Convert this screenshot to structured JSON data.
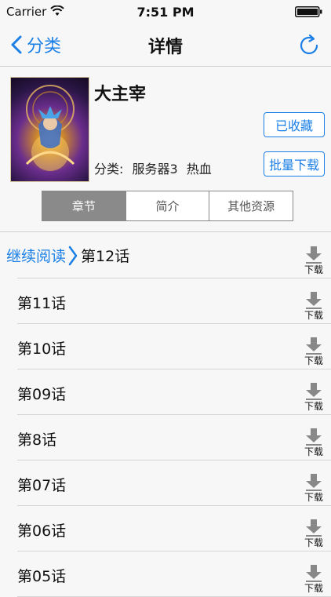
{
  "status_bar": {
    "carrier": "Carrier",
    "time": "7:51 PM"
  },
  "nav": {
    "back_label": "分类",
    "title": "详情"
  },
  "book": {
    "title": "大主宰",
    "category_label": "分类:",
    "server": "服务器3",
    "genre": "热血",
    "favorite_label": "已收藏",
    "batch_download_label": "批量下载"
  },
  "tabs": [
    {
      "label": "章节",
      "active": true
    },
    {
      "label": "简介",
      "active": false
    },
    {
      "label": "其他资源",
      "active": false
    }
  ],
  "continue_reading": {
    "label": "继续阅读",
    "chapter": "第12话"
  },
  "chapters": [
    "第11话",
    "第10话",
    "第09话",
    "第8话",
    "第07话",
    "第06话",
    "第05话"
  ],
  "download_label": "下载",
  "colors": {
    "accent": "#1a7fe6",
    "tab_active_bg": "#8a8a8a"
  }
}
